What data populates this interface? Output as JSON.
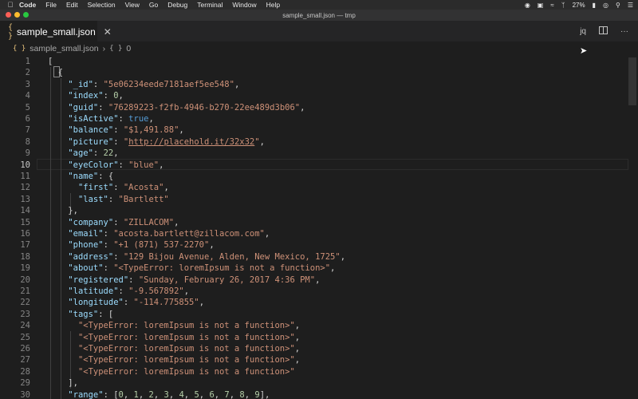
{
  "menubar": {
    "app": "Code",
    "items": [
      "File",
      "Edit",
      "Selection",
      "View",
      "Go",
      "Debug",
      "Terminal",
      "Window",
      "Help"
    ],
    "status": {
      "battery": "27%"
    }
  },
  "window": {
    "title": "sample_small.json — tmp"
  },
  "tab": {
    "filename": "sample_small.json",
    "icon": "{ }"
  },
  "tabactions": {
    "jq": "jq"
  },
  "breadcrumbs": {
    "file": "sample_small.json",
    "node": "0"
  },
  "lines": [
    {
      "n": "1",
      "tokens": [
        [
          "p",
          "["
        ]
      ]
    },
    {
      "n": "2",
      "tokens": [
        [
          "p",
          "  {"
        ]
      ]
    },
    {
      "n": "3",
      "tokens": [
        [
          "p",
          "    "
        ],
        [
          "k",
          "\"_id\""
        ],
        [
          "p",
          ": "
        ],
        [
          "s",
          "\"5e06234eede7181aef5ee548\""
        ],
        [
          "p",
          ","
        ]
      ]
    },
    {
      "n": "4",
      "tokens": [
        [
          "p",
          "    "
        ],
        [
          "k",
          "\"index\""
        ],
        [
          "p",
          ": "
        ],
        [
          "n",
          "0"
        ],
        [
          "p",
          ","
        ]
      ]
    },
    {
      "n": "5",
      "tokens": [
        [
          "p",
          "    "
        ],
        [
          "k",
          "\"guid\""
        ],
        [
          "p",
          ": "
        ],
        [
          "s",
          "\"76289223-f2fb-4946-b270-22ee489d3b06\""
        ],
        [
          "p",
          ","
        ]
      ]
    },
    {
      "n": "6",
      "tokens": [
        [
          "p",
          "    "
        ],
        [
          "k",
          "\"isActive\""
        ],
        [
          "p",
          ": "
        ],
        [
          "b",
          "true"
        ],
        [
          "p",
          ","
        ]
      ]
    },
    {
      "n": "7",
      "tokens": [
        [
          "p",
          "    "
        ],
        [
          "k",
          "\"balance\""
        ],
        [
          "p",
          ": "
        ],
        [
          "s",
          "\"$1,491.88\""
        ],
        [
          "p",
          ","
        ]
      ]
    },
    {
      "n": "8",
      "tokens": [
        [
          "p",
          "    "
        ],
        [
          "k",
          "\"picture\""
        ],
        [
          "p",
          ": "
        ],
        [
          "s",
          "\""
        ],
        [
          "u",
          "http://placehold.it/32x32"
        ],
        [
          "s",
          "\""
        ],
        [
          "p",
          ","
        ]
      ]
    },
    {
      "n": "9",
      "tokens": [
        [
          "p",
          "    "
        ],
        [
          "k",
          "\"age\""
        ],
        [
          "p",
          ": "
        ],
        [
          "n",
          "22"
        ],
        [
          "p",
          ","
        ]
      ]
    },
    {
      "n": "10",
      "tokens": [
        [
          "p",
          "    "
        ],
        [
          "k",
          "\"eyeColor\""
        ],
        [
          "p",
          ": "
        ],
        [
          "s",
          "\"blue\""
        ],
        [
          "p",
          ","
        ]
      ]
    },
    {
      "n": "11",
      "tokens": [
        [
          "p",
          "    "
        ],
        [
          "k",
          "\"name\""
        ],
        [
          "p",
          ": {"
        ]
      ]
    },
    {
      "n": "12",
      "tokens": [
        [
          "p",
          "      "
        ],
        [
          "k",
          "\"first\""
        ],
        [
          "p",
          ": "
        ],
        [
          "s",
          "\"Acosta\""
        ],
        [
          "p",
          ","
        ]
      ]
    },
    {
      "n": "13",
      "tokens": [
        [
          "p",
          "      "
        ],
        [
          "k",
          "\"last\""
        ],
        [
          "p",
          ": "
        ],
        [
          "s",
          "\"Bartlett\""
        ]
      ]
    },
    {
      "n": "14",
      "tokens": [
        [
          "p",
          "    },"
        ]
      ]
    },
    {
      "n": "15",
      "tokens": [
        [
          "p",
          "    "
        ],
        [
          "k",
          "\"company\""
        ],
        [
          "p",
          ": "
        ],
        [
          "s",
          "\"ZILLACOM\""
        ],
        [
          "p",
          ","
        ]
      ]
    },
    {
      "n": "16",
      "tokens": [
        [
          "p",
          "    "
        ],
        [
          "k",
          "\"email\""
        ],
        [
          "p",
          ": "
        ],
        [
          "s",
          "\"acosta.bartlett@zillacom.com\""
        ],
        [
          "p",
          ","
        ]
      ]
    },
    {
      "n": "17",
      "tokens": [
        [
          "p",
          "    "
        ],
        [
          "k",
          "\"phone\""
        ],
        [
          "p",
          ": "
        ],
        [
          "s",
          "\"+1 (871) 537-2270\""
        ],
        [
          "p",
          ","
        ]
      ]
    },
    {
      "n": "18",
      "tokens": [
        [
          "p",
          "    "
        ],
        [
          "k",
          "\"address\""
        ],
        [
          "p",
          ": "
        ],
        [
          "s",
          "\"129 Bijou Avenue, Alden, New Mexico, 1725\""
        ],
        [
          "p",
          ","
        ]
      ]
    },
    {
      "n": "19",
      "tokens": [
        [
          "p",
          "    "
        ],
        [
          "k",
          "\"about\""
        ],
        [
          "p",
          ": "
        ],
        [
          "s",
          "\"<TypeError: loremIpsum is not a function>\""
        ],
        [
          "p",
          ","
        ]
      ]
    },
    {
      "n": "20",
      "tokens": [
        [
          "p",
          "    "
        ],
        [
          "k",
          "\"registered\""
        ],
        [
          "p",
          ": "
        ],
        [
          "s",
          "\"Sunday, February 26, 2017 4:36 PM\""
        ],
        [
          "p",
          ","
        ]
      ]
    },
    {
      "n": "21",
      "tokens": [
        [
          "p",
          "    "
        ],
        [
          "k",
          "\"latitude\""
        ],
        [
          "p",
          ": "
        ],
        [
          "s",
          "\"-9.567892\""
        ],
        [
          "p",
          ","
        ]
      ]
    },
    {
      "n": "22",
      "tokens": [
        [
          "p",
          "    "
        ],
        [
          "k",
          "\"longitude\""
        ],
        [
          "p",
          ": "
        ],
        [
          "s",
          "\"-114.775855\""
        ],
        [
          "p",
          ","
        ]
      ]
    },
    {
      "n": "23",
      "tokens": [
        [
          "p",
          "    "
        ],
        [
          "k",
          "\"tags\""
        ],
        [
          "p",
          ": ["
        ]
      ]
    },
    {
      "n": "24",
      "tokens": [
        [
          "p",
          "      "
        ],
        [
          "s",
          "\"<TypeError: loremIpsum is not a function>\""
        ],
        [
          "p",
          ","
        ]
      ]
    },
    {
      "n": "25",
      "tokens": [
        [
          "p",
          "      "
        ],
        [
          "s",
          "\"<TypeError: loremIpsum is not a function>\""
        ],
        [
          "p",
          ","
        ]
      ]
    },
    {
      "n": "26",
      "tokens": [
        [
          "p",
          "      "
        ],
        [
          "s",
          "\"<TypeError: loremIpsum is not a function>\""
        ],
        [
          "p",
          ","
        ]
      ]
    },
    {
      "n": "27",
      "tokens": [
        [
          "p",
          "      "
        ],
        [
          "s",
          "\"<TypeError: loremIpsum is not a function>\""
        ],
        [
          "p",
          ","
        ]
      ]
    },
    {
      "n": "28",
      "tokens": [
        [
          "p",
          "      "
        ],
        [
          "s",
          "\"<TypeError: loremIpsum is not a function>\""
        ]
      ]
    },
    {
      "n": "29",
      "tokens": [
        [
          "p",
          "    ],"
        ]
      ]
    },
    {
      "n": "30",
      "tokens": [
        [
          "p",
          "    "
        ],
        [
          "k",
          "\"range\""
        ],
        [
          "p",
          ": ["
        ],
        [
          "n",
          "0"
        ],
        [
          "p",
          ", "
        ],
        [
          "n",
          "1"
        ],
        [
          "p",
          ", "
        ],
        [
          "n",
          "2"
        ],
        [
          "p",
          ", "
        ],
        [
          "n",
          "3"
        ],
        [
          "p",
          ", "
        ],
        [
          "n",
          "4"
        ],
        [
          "p",
          ", "
        ],
        [
          "n",
          "5"
        ],
        [
          "p",
          ", "
        ],
        [
          "n",
          "6"
        ],
        [
          "p",
          ", "
        ],
        [
          "n",
          "7"
        ],
        [
          "p",
          ", "
        ],
        [
          "n",
          "8"
        ],
        [
          "p",
          ", "
        ],
        [
          "n",
          "9"
        ],
        [
          "p",
          "],"
        ]
      ]
    }
  ],
  "current_line": "10",
  "icons": {
    "apple": "apple-icon",
    "split": "split-editor-icon",
    "more": "more-actions-icon",
    "close": "close-icon",
    "file": "json-file-icon"
  }
}
